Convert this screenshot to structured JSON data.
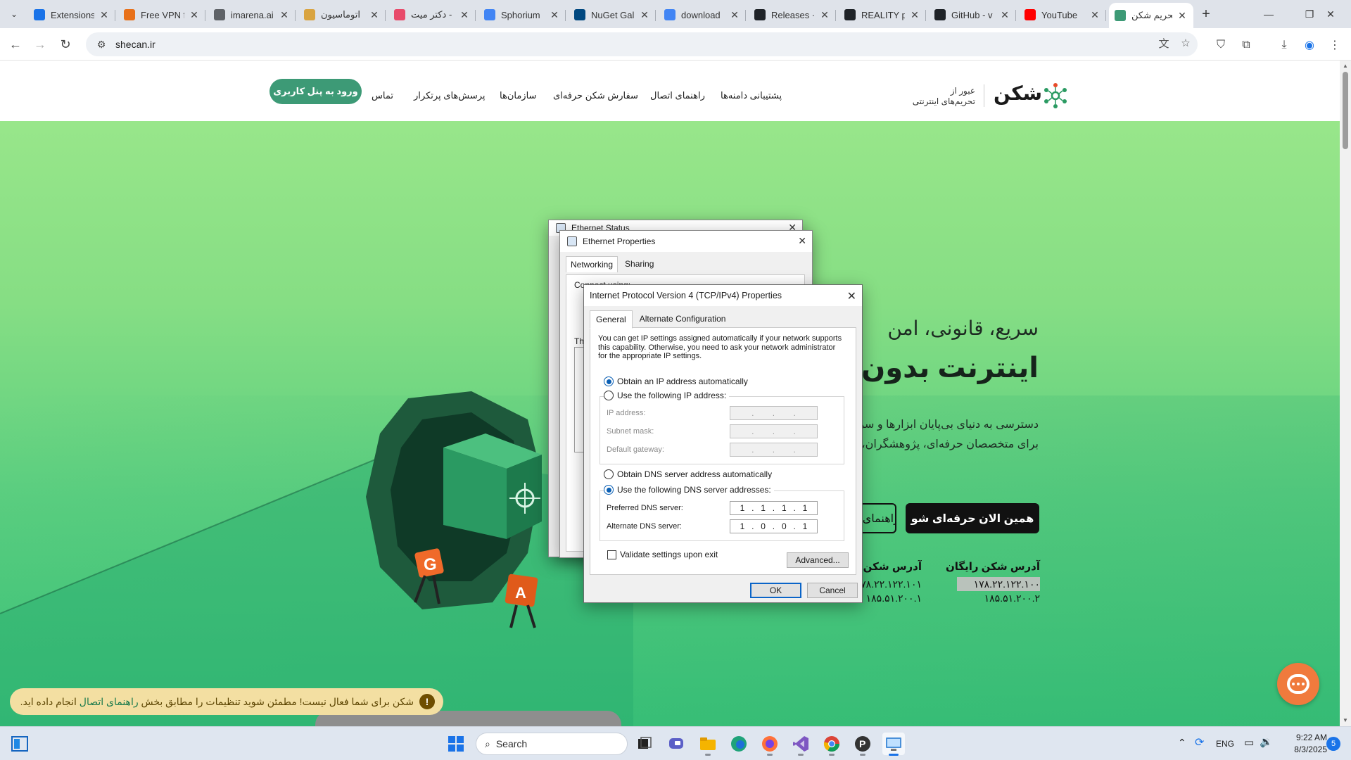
{
  "browser": {
    "tabs": [
      {
        "label": "Extensions",
        "icon": "puzzle-icon",
        "color": "#1a73e8"
      },
      {
        "label": "Free VPN f",
        "icon": "rainbow-icon",
        "color": "#e8711a"
      },
      {
        "label": "imarena.ai",
        "icon": "globe-icon",
        "color": "#5f6368"
      },
      {
        "label": "اتوماسیون",
        "icon": "chat-icon",
        "color": "#d9a441"
      },
      {
        "label": "دکتر میت -",
        "icon": "doctor-icon",
        "color": "#e84b6b"
      },
      {
        "label": "Sphorium",
        "icon": "google-icon",
        "color": "#4285f4"
      },
      {
        "label": "NuGet Gal",
        "icon": "nuget-icon",
        "color": "#004880"
      },
      {
        "label": "download",
        "icon": "google-icon",
        "color": "#4285f4"
      },
      {
        "label": "Releases ·",
        "icon": "github-icon",
        "color": "#1f2328"
      },
      {
        "label": "REALITY p",
        "icon": "github-icon",
        "color": "#1f2328"
      },
      {
        "label": "GitHub - v",
        "icon": "github-icon",
        "color": "#1f2328"
      },
      {
        "label": "YouTube",
        "icon": "youtube-icon",
        "color": "#ff0000"
      },
      {
        "label": "تحریم شکن",
        "icon": "shecan-icon",
        "color": "#3d9a76",
        "active": true
      }
    ],
    "url": "shecan.ir"
  },
  "site": {
    "logo_text": "شکن",
    "tagline_line1": "عبور از",
    "tagline_line2": "تحریم‌های اینترنتی",
    "nav": {
      "domain_support": "پشتیبانی دامنه‌ها",
      "connection_guides": "راهنمای اتصال",
      "order_pro": "سفارش شکن حرفه‌ای",
      "organizations": "سازمان‌ها",
      "faq": "پرسش‌های پرتکرار",
      "contact": "تماس",
      "login": "ورود به پنل کاربری"
    },
    "hero": {
      "subtitle": "سریع، قانونی، امن",
      "title": "اینترنت بدون تحریم",
      "desc_line1": "دسترسی به دنیای بی‌پایان ابزارها و سرویس‌ها",
      "desc_line2": "برای متخصصان حرفه‌ای، پژوهشگران، دانشجویان",
      "cta_primary": "همین الان حرفه‌ای شو",
      "cta_secondary": "راهنمای اتصال"
    },
    "free_address": {
      "heading": "آدرس شکن رایگان",
      "primary": "۱۷۸.۲۲.۱۲۲.۱۰۰",
      "secondary": "۱۸۵.۵۱.۲۰۰.۲"
    },
    "pro_address": {
      "heading": "آدرس شکن حرفه‌ای",
      "primary": "۱۷۸.۲۲.۱۲۲.۱۰۱",
      "secondary": "۱۸۵.۵۱.۲۰۰.۱"
    },
    "notice_text_before": "شکن برای شما فعال نیست! مطمئن شوید تنظیمات را مطابق بخش",
    "notice_link": "راهنمای اتصال",
    "notice_text_after": "انجام داده اید.",
    "notice_icon": "!",
    "colors": {
      "brand": "#3d9a76",
      "chat": "#f07a3d",
      "notice": "#f3dfa2"
    }
  },
  "dialogs": {
    "ethernet_status_title": "Ethernet Status",
    "ethernet_props": {
      "title": "Ethernet Properties",
      "tab_networking": "Networking",
      "tab_sharing": "Sharing",
      "connect_using": "Connect using:",
      "this_connection": "Th"
    },
    "ipv4": {
      "title": "Internet Protocol Version 4 (TCP/IPv4) Properties",
      "tab_general": "General",
      "tab_alternate": "Alternate Configuration",
      "intro": "You can get IP settings assigned automatically if your network supports this capability. Otherwise, you need to ask your network administrator for the appropriate IP settings.",
      "obtain_ip_auto": "Obtain an IP address automatically",
      "use_following_ip": "Use the following IP address:",
      "ip_address_label": "IP address:",
      "subnet_label": "Subnet mask:",
      "gateway_label": "Default gateway:",
      "obtain_dns_auto": "Obtain DNS server address automatically",
      "use_following_dns": "Use the following DNS server addresses:",
      "preferred_dns_label": "Preferred DNS server:",
      "alternate_dns_label": "Alternate DNS server:",
      "preferred_dns": [
        "1",
        "1",
        "1",
        "1"
      ],
      "alternate_dns": [
        "1",
        "0",
        "0",
        "1"
      ],
      "dot": ".",
      "validate_label": "Validate settings upon exit",
      "advanced": "Advanced...",
      "ok": "OK",
      "cancel": "Cancel"
    }
  },
  "taskbar": {
    "search_placeholder": "Search",
    "language": "ENG",
    "time": "9:22 AM",
    "date": "8/3/2025",
    "notification_count": "5"
  }
}
